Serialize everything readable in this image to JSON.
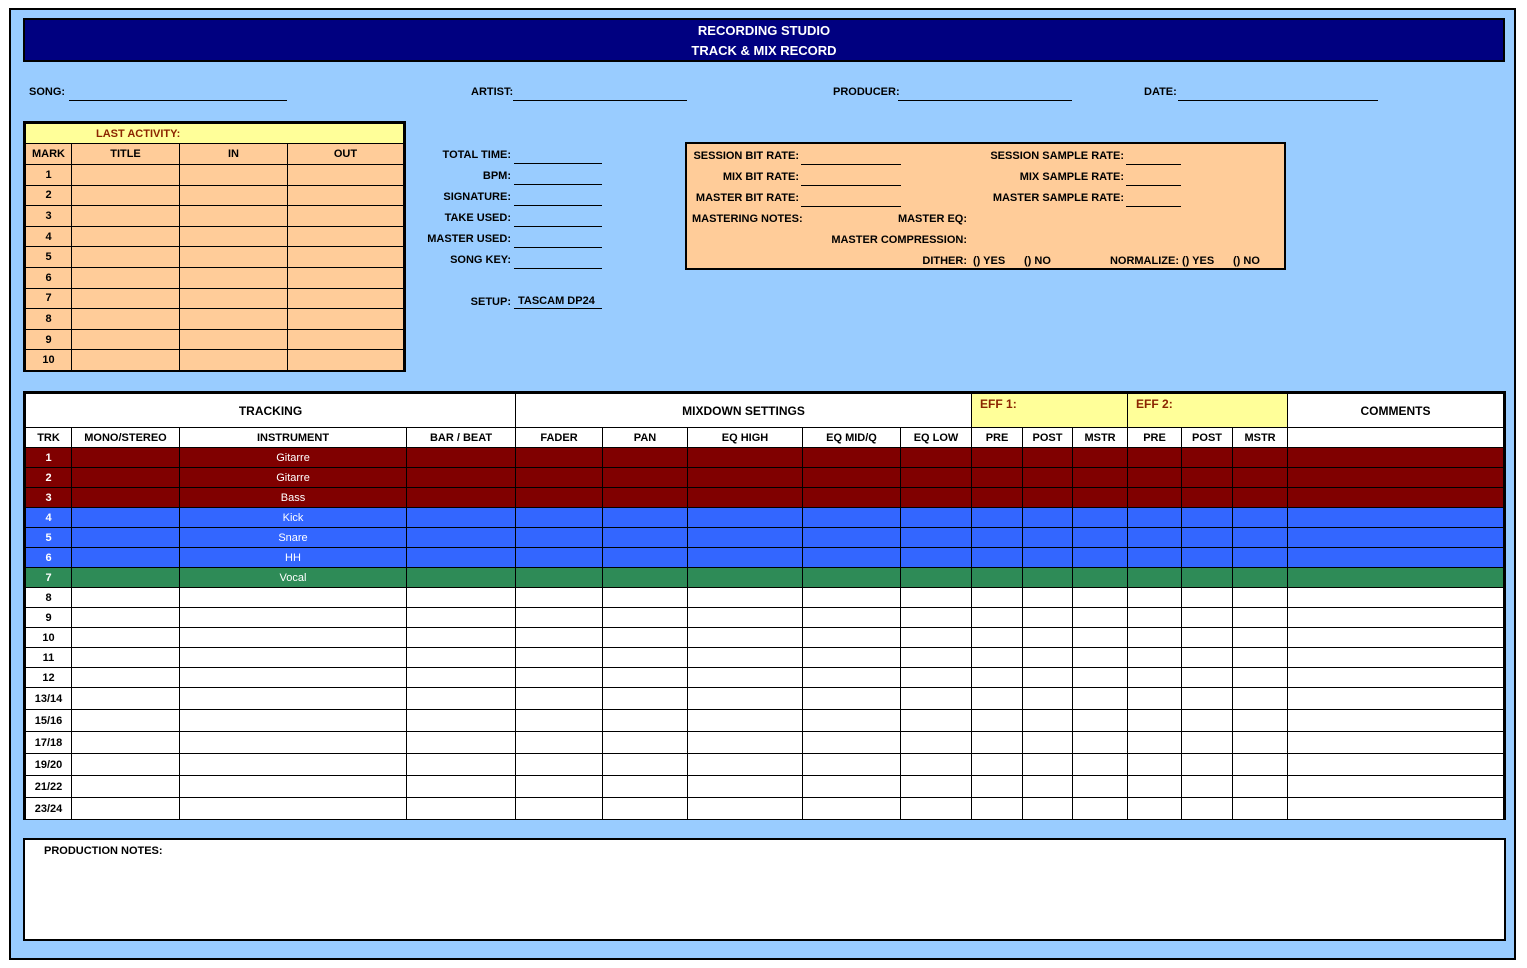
{
  "header": {
    "title_line1": "RECORDING STUDIO",
    "title_line2": "TRACK & MIX RECORD"
  },
  "info": {
    "song_label": "SONG:",
    "artist_label": "ARTIST:",
    "producer_label": "PRODUCER:",
    "date_label": "DATE:"
  },
  "marks": {
    "last_activity_label": "LAST ACTIVITY:",
    "columns": [
      "MARK",
      "TITLE",
      "IN",
      "OUT"
    ],
    "rows": [
      "1",
      "2",
      "3",
      "4",
      "5",
      "6",
      "7",
      "8",
      "9",
      "10"
    ]
  },
  "timing": {
    "labels": [
      "TOTAL TIME:",
      "BPM:",
      "SIGNATURE:",
      "TAKE USED:",
      "MASTER USED:",
      "SONG KEY:"
    ],
    "setup_label": "SETUP:",
    "setup_value": "TASCAM DP24"
  },
  "settings": {
    "session_bit_rate": "SESSION BIT RATE:",
    "mix_bit_rate": "MIX BIT RATE:",
    "master_bit_rate": "MASTER BIT RATE:",
    "session_sample_rate": "SESSION SAMPLE RATE:",
    "mix_sample_rate": "MIX SAMPLE RATE:",
    "master_sample_rate": "MASTER SAMPLE RATE:",
    "mastering_notes": "MASTERING NOTES:",
    "master_eq": "MASTER EQ:",
    "master_compression": "MASTER COMPRESSION:",
    "dither": "DITHER:",
    "dither_yes": "() YES",
    "dither_no": "() NO",
    "normalize": "NORMALIZE:",
    "normalize_yes": "() YES",
    "normalize_no": "() NO"
  },
  "tracking": {
    "groups": {
      "tracking": "TRACKING",
      "mixdown": "MIXDOWN SETTINGS",
      "eff1": "EFF 1:",
      "eff2": "EFF 2:",
      "comments": "COMMENTS"
    },
    "columns": [
      "TRK",
      "MONO/STEREO",
      "INSTRUMENT",
      "BAR / BEAT",
      "FADER",
      "PAN",
      "EQ HIGH",
      "EQ MID/Q",
      "EQ LOW",
      "PRE",
      "POST",
      "MSTR",
      "PRE",
      "POST",
      "MSTR"
    ],
    "rows": [
      {
        "trk": "1",
        "instrument": "Gitarre",
        "color": "red"
      },
      {
        "trk": "2",
        "instrument": "Gitarre",
        "color": "red"
      },
      {
        "trk": "3",
        "instrument": "Bass",
        "color": "red"
      },
      {
        "trk": "4",
        "instrument": "Kick",
        "color": "blue"
      },
      {
        "trk": "5",
        "instrument": "Snare",
        "color": "blue"
      },
      {
        "trk": "6",
        "instrument": "HH",
        "color": "blue"
      },
      {
        "trk": "7",
        "instrument": "Vocal",
        "color": "green"
      },
      {
        "trk": "8",
        "instrument": "",
        "color": "white"
      },
      {
        "trk": "9",
        "instrument": "",
        "color": "white"
      },
      {
        "trk": "10",
        "instrument": "",
        "color": "white"
      },
      {
        "trk": "11",
        "instrument": "",
        "color": "white"
      },
      {
        "trk": "12",
        "instrument": "",
        "color": "white"
      },
      {
        "trk": "13/14",
        "instrument": "",
        "color": "white"
      },
      {
        "trk": "15/16",
        "instrument": "",
        "color": "white"
      },
      {
        "trk": "17/18",
        "instrument": "",
        "color": "white"
      },
      {
        "trk": "19/20",
        "instrument": "",
        "color": "white"
      },
      {
        "trk": "21/22",
        "instrument": "",
        "color": "white"
      },
      {
        "trk": "23/24",
        "instrument": "",
        "color": "white"
      }
    ]
  },
  "notes": {
    "label": "PRODUCTION NOTES:"
  },
  "colors": {
    "title_bg": "#000080",
    "sheet_bg": "#99ccff",
    "peach": "#ffcc99",
    "yellow": "#ffff99",
    "track_red": "#800000",
    "track_blue": "#3366ff",
    "track_green": "#2e8b57"
  }
}
